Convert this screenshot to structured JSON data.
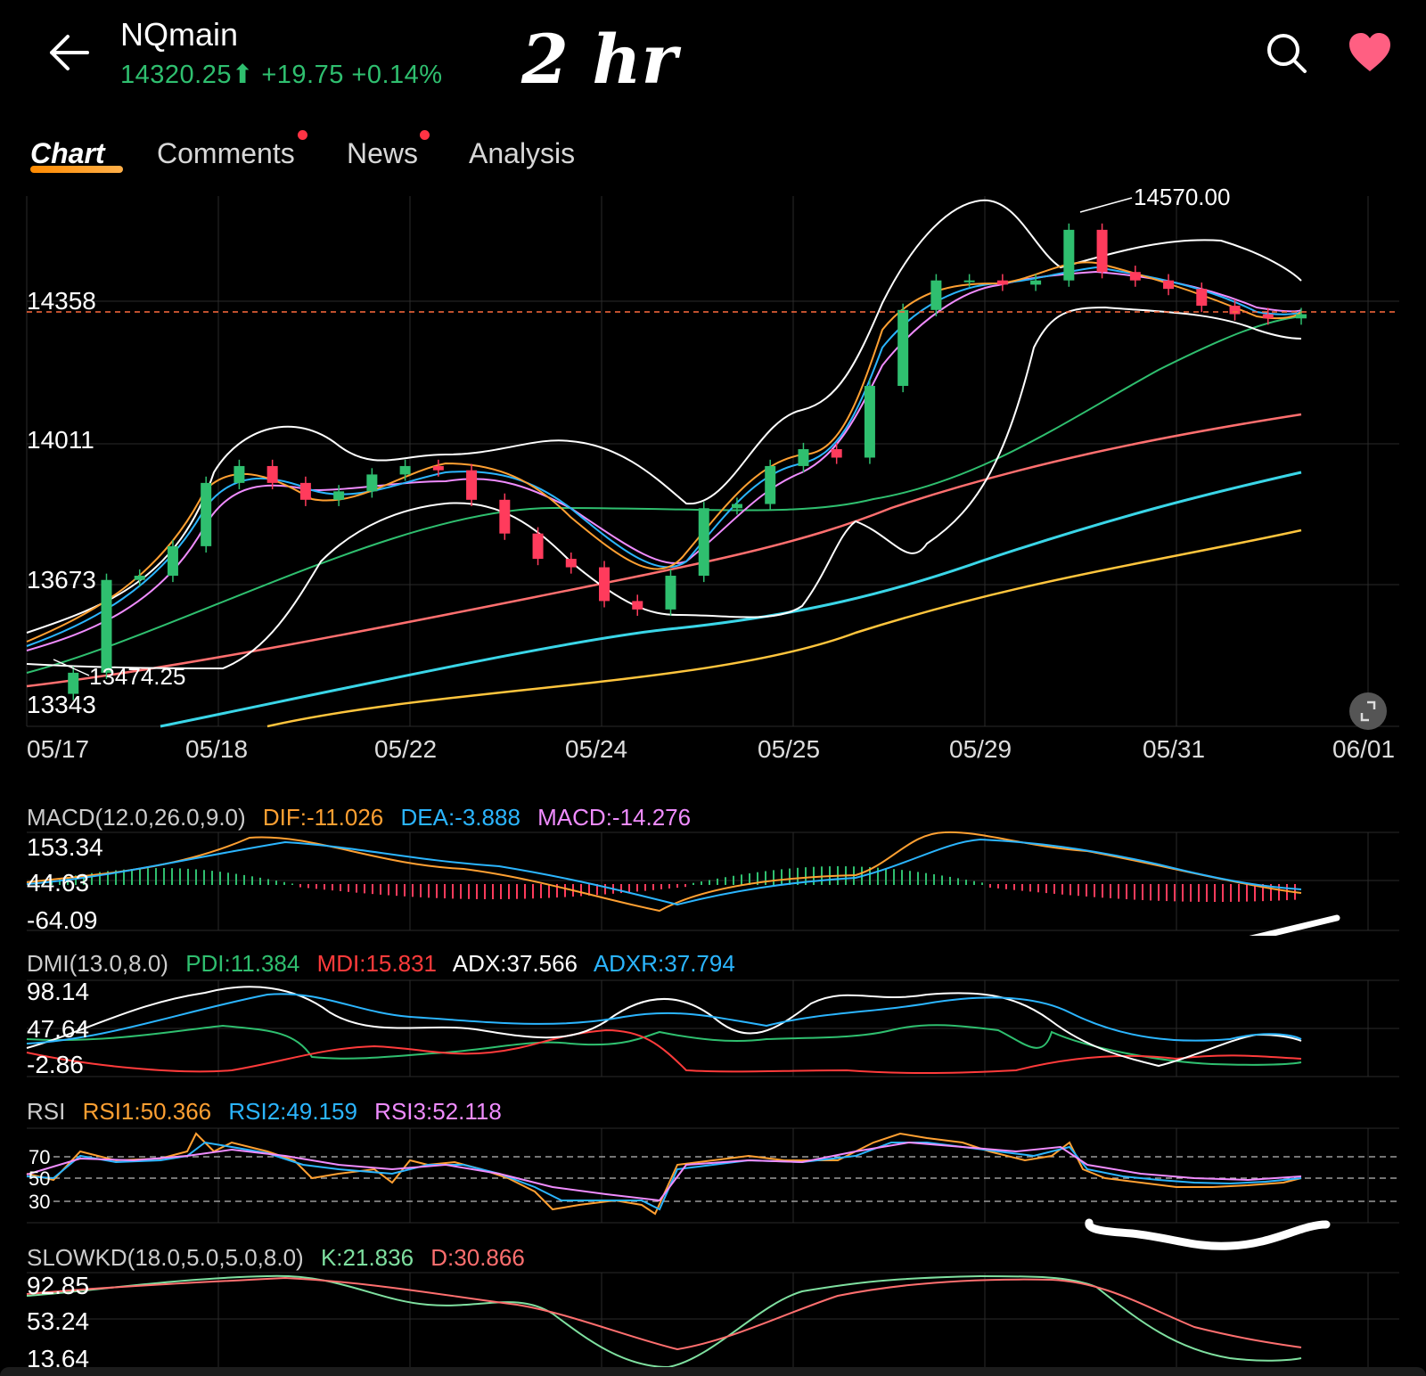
{
  "header": {
    "symbol": "NQmain",
    "price": "14320.25",
    "change": "+19.75",
    "change_pct": "+0.14%",
    "annotation": "2 hr",
    "up_color": "#2fbf6f"
  },
  "tabs": [
    {
      "label": "Chart",
      "active": true,
      "dot": false
    },
    {
      "label": "Comments",
      "active": false,
      "dot": true
    },
    {
      "label": "News",
      "active": false,
      "dot": true
    },
    {
      "label": "Analysis",
      "active": false,
      "dot": false
    }
  ],
  "icons": {
    "back": "back-arrow-icon",
    "search": "search-icon",
    "favorite": "heart-icon",
    "expand": "expand-icon"
  },
  "chart_data": [
    {
      "type": "candlestick",
      "price_labels": [
        "14358",
        "14011",
        "13673",
        "13343"
      ],
      "high_label": "14570.00",
      "low_label": "13474.25",
      "current_price_line": 14330,
      "dates": [
        "05/17",
        "05/18",
        "05/22",
        "05/24",
        "05/25",
        "05/29",
        "05/31",
        "06/01"
      ],
      "ylim": [
        13343,
        14600
      ],
      "series": [
        {
          "name": "close",
          "values": [
            13420,
            13470,
            13690,
            13700,
            13770,
            13920,
            13960,
            13920,
            13880,
            13900,
            13940,
            13960,
            13950,
            13880,
            13800,
            13740,
            13720,
            13640,
            13620,
            13700,
            13860,
            13870,
            13960,
            14000,
            13980,
            14150,
            14330,
            14400,
            14400,
            14390,
            14400,
            14520,
            14420,
            14400,
            14380,
            14340,
            14320,
            14310,
            14320
          ]
        }
      ],
      "legend": "none"
    },
    {
      "type": "line",
      "name_label": "MACD(12.0,26.0,9.0)",
      "values": {
        "DIF": "DIF:-11.026",
        "DEA": "DEA:-3.888",
        "MACD": "MACD:-14.276"
      },
      "y_labels": [
        "153.34",
        "44.63",
        "-64.09"
      ]
    },
    {
      "type": "line",
      "name_label": "DMI(13.0,8.0)",
      "values": {
        "PDI": "PDI:11.384",
        "MDI": "MDI:15.831",
        "ADX": "ADX:37.566",
        "ADXR": "ADXR:37.794"
      },
      "y_labels": [
        "98.14",
        "47.64",
        "-2.86"
      ]
    },
    {
      "type": "line",
      "name_label": "RSI",
      "values": {
        "RSI1": "RSI1:50.366",
        "RSI2": "RSI2:49.159",
        "RSI3": "RSI3:52.118"
      },
      "y_labels": [
        "70",
        "50",
        "30"
      ]
    },
    {
      "type": "line",
      "name_label": "SLOWKD(18.0,5.0,5.0,8.0)",
      "values": {
        "K": "K:21.836",
        "D": "D:30.866"
      },
      "y_labels": [
        "92.85",
        "53.24",
        "13.64"
      ]
    }
  ],
  "colors": {
    "up": "#2fbf6f",
    "down": "#ff3b5c",
    "orange": "#ffa032",
    "blue": "#2bb5ff",
    "pink": "#f08cff",
    "white": "#ffffff",
    "red": "#ff3b3b",
    "green": "#2fbf6f",
    "salmon": "#ff6f6f",
    "cyan": "#3ad6e8",
    "yellow": "#ffc53d"
  }
}
